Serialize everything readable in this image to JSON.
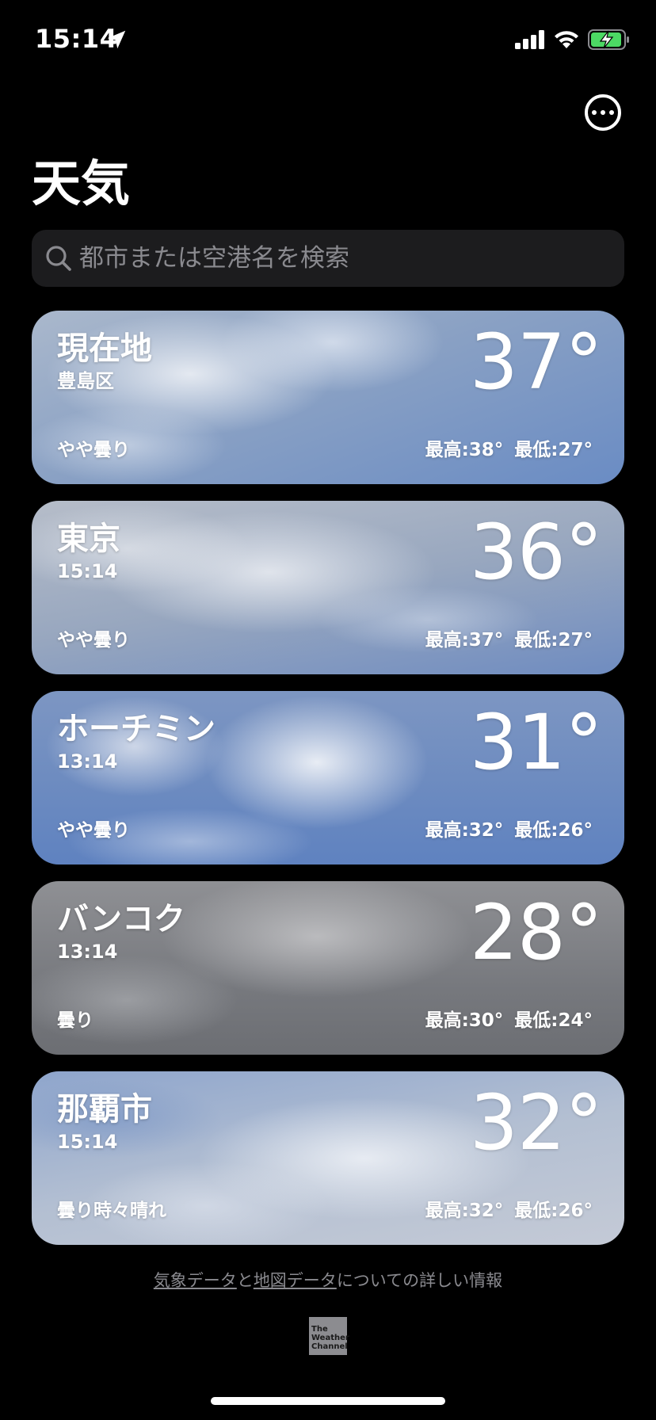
{
  "status_bar": {
    "time": "15:14",
    "location_icon": "location-arrow-icon",
    "signal_icon": "cellular-signal-icon",
    "wifi_icon": "wifi-icon",
    "battery_icon": "battery-charging-icon",
    "battery_color": "#4cd964"
  },
  "header": {
    "more_icon": "ellipsis-circle-icon",
    "title": "天気"
  },
  "search": {
    "icon": "search-icon",
    "placeholder": "都市または空港名を検索"
  },
  "cities": [
    {
      "name": "現在地",
      "subtitle": "豊島区",
      "temperature": "37°",
      "condition": "やや曇り",
      "high": "最高:38°",
      "low": "最低:27°"
    },
    {
      "name": "東京",
      "subtitle": "15:14",
      "temperature": "36°",
      "condition": "やや曇り",
      "high": "最高:37°",
      "low": "最低:27°"
    },
    {
      "name": "ホーチミン",
      "subtitle": "13:14",
      "temperature": "31°",
      "condition": "やや曇り",
      "high": "最高:32°",
      "low": "最低:26°"
    },
    {
      "name": "バンコク",
      "subtitle": "13:14",
      "temperature": "28°",
      "condition": "曇り",
      "high": "最高:30°",
      "low": "最低:24°"
    },
    {
      "name": "那覇市",
      "subtitle": "15:14",
      "temperature": "32°",
      "condition": "曇り時々晴れ",
      "high": "最高:32°",
      "low": "最低:26°"
    }
  ],
  "footer": {
    "weather_data_link": "気象データ",
    "connector": "と",
    "map_data_link": "地図データ",
    "suffix": "についての詳しい情報",
    "logo_line1": "The",
    "logo_line2": "Weather",
    "logo_line3": "Channel"
  }
}
